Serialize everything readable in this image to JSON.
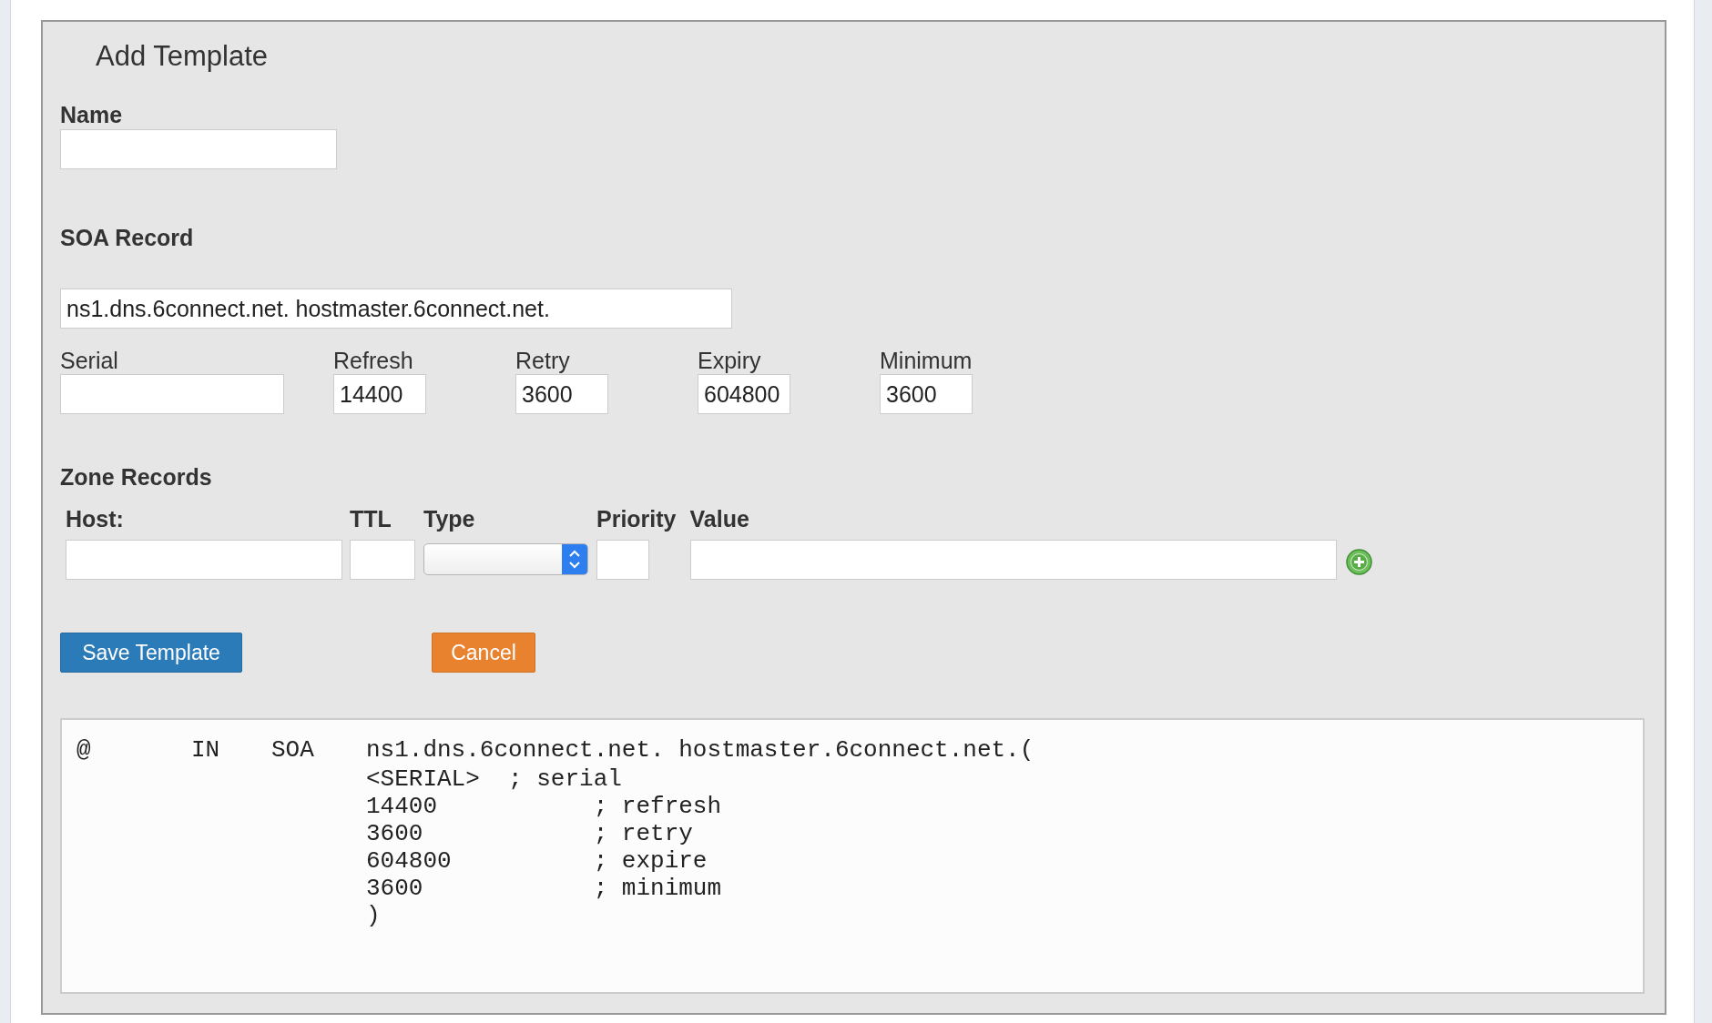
{
  "title": "Add Template",
  "name_field": {
    "label": "Name"
  },
  "soa": {
    "heading": "SOA Record",
    "value": "ns1.dns.6connect.net. hostmaster.6connect.net.",
    "fields": [
      {
        "label": "Serial"
      },
      {
        "label": "Refresh",
        "value": "14400"
      },
      {
        "label": "Retry",
        "value": "3600"
      },
      {
        "label": "Expiry",
        "value": "604800"
      },
      {
        "label": "Minimum",
        "value": "3600"
      }
    ]
  },
  "zone_records": {
    "heading": "Zone Records",
    "columns": [
      {
        "label": "Host:",
        "kind": "text"
      },
      {
        "label": "TTL",
        "kind": "text"
      },
      {
        "label": "Type",
        "kind": "select"
      },
      {
        "label": "Priority",
        "kind": "text"
      },
      {
        "label": "Value",
        "kind": "text"
      }
    ]
  },
  "buttons": [
    {
      "label": "Save Template",
      "kind": "primary"
    },
    {
      "label": "Cancel",
      "kind": "cancel"
    }
  ],
  "preview": {
    "header": [
      "@",
      "IN",
      "SOA",
      "ns1.dns.6connect.net. hostmaster.6connect.net.("
    ],
    "lines": [
      "<SERIAL>  ; serial",
      "14400           ; refresh",
      "3600            ; retry",
      "604800          ; expire",
      "3600            ; minimum",
      ")"
    ]
  }
}
